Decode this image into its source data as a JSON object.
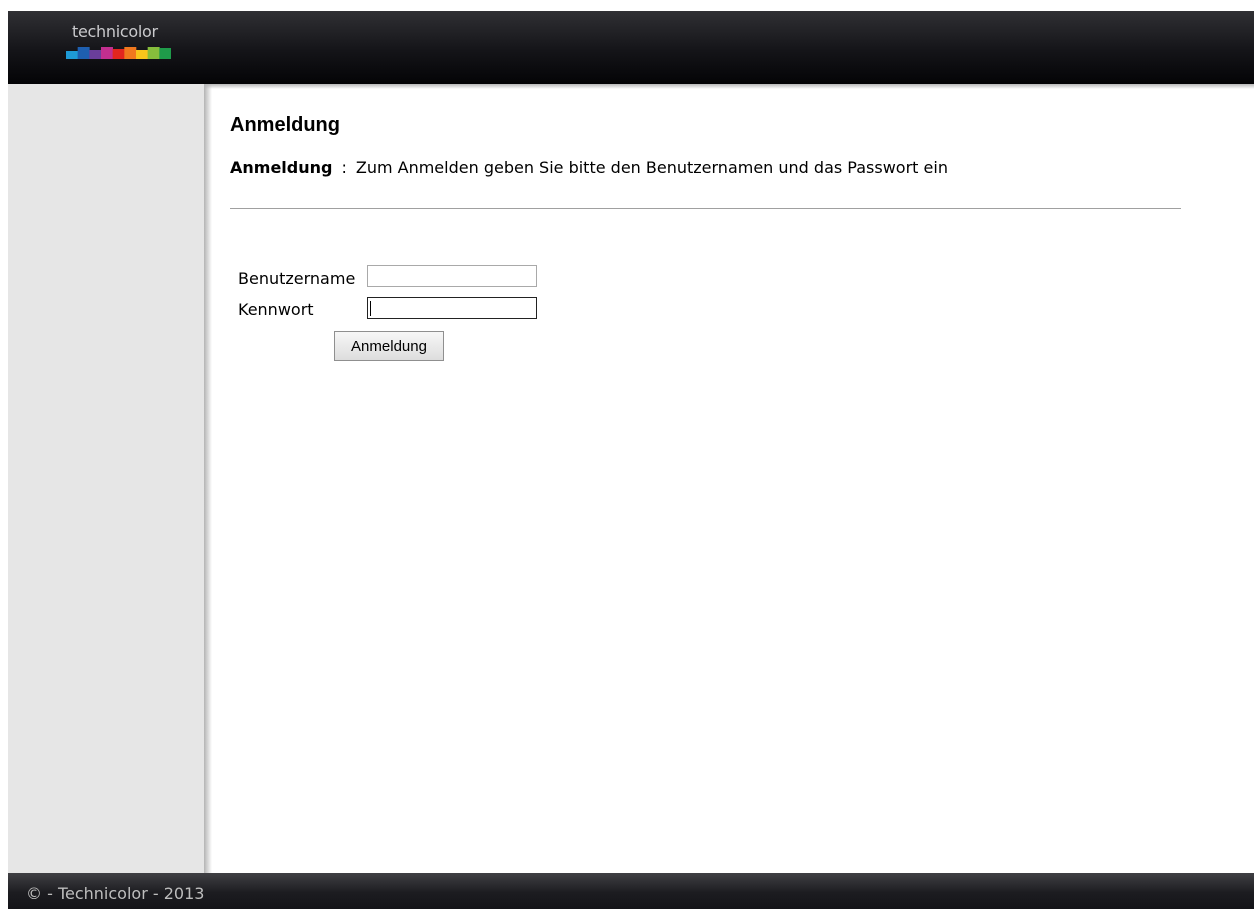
{
  "header": {
    "logo_text": "technicolor",
    "logo_colors": [
      "#1e9ad6",
      "#1e5fb0",
      "#6a3e9b",
      "#c22f8f",
      "#e2261f",
      "#f0781e",
      "#f7c51b",
      "#86bd3c",
      "#1f9b4a"
    ]
  },
  "main": {
    "title": "Anmeldung",
    "description_label": "Anmeldung",
    "description_separator": ":",
    "description_text": "Zum Anmelden geben Sie bitte den Benutzernamen und das Passwort ein"
  },
  "form": {
    "username_label": "Benutzername",
    "username_value": "",
    "password_label": "Kennwort",
    "password_value": "",
    "submit_label": "Anmeldung"
  },
  "footer": {
    "copyright": "© - Technicolor - 2013"
  }
}
